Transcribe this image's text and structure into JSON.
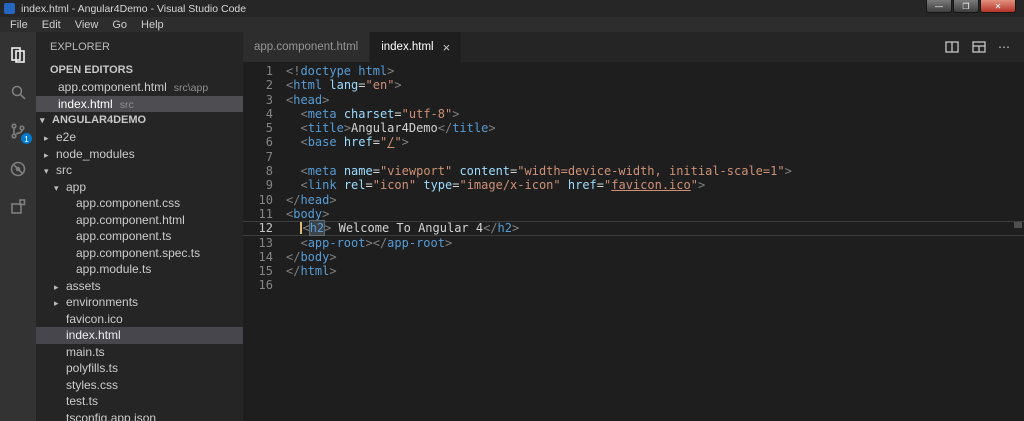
{
  "window": {
    "title": "index.html - Angular4Demo - Visual Studio Code",
    "controls": {
      "minimize": "—",
      "maximize": "❐",
      "close": "✕"
    }
  },
  "menu": {
    "items": [
      "File",
      "Edit",
      "View",
      "Go",
      "Help"
    ]
  },
  "activity_bar": {
    "source_control_badge": "1"
  },
  "sidebar": {
    "title": "EXPLORER",
    "open_editors_label": "OPEN EDITORS",
    "open_editors": [
      {
        "name": "app.component.html",
        "path": "src\\app",
        "selected": false
      },
      {
        "name": "index.html",
        "path": "src",
        "selected": true
      }
    ],
    "project_label": "ANGULAR4DEMO",
    "tree": [
      {
        "label": "e2e",
        "type": "folder",
        "expanded": false,
        "level": 0
      },
      {
        "label": "node_modules",
        "type": "folder",
        "expanded": false,
        "level": 0
      },
      {
        "label": "src",
        "type": "folder",
        "expanded": true,
        "level": 0
      },
      {
        "label": "app",
        "type": "folder",
        "expanded": true,
        "level": 1
      },
      {
        "label": "app.component.css",
        "type": "file",
        "level": 2
      },
      {
        "label": "app.component.html",
        "type": "file",
        "level": 2
      },
      {
        "label": "app.component.ts",
        "type": "file",
        "level": 2
      },
      {
        "label": "app.component.spec.ts",
        "type": "file",
        "level": 2
      },
      {
        "label": "app.module.ts",
        "type": "file",
        "level": 2
      },
      {
        "label": "assets",
        "type": "folder",
        "expanded": false,
        "level": 1
      },
      {
        "label": "environments",
        "type": "folder",
        "expanded": false,
        "level": 1
      },
      {
        "label": "favicon.ico",
        "type": "file",
        "level": 1
      },
      {
        "label": "index.html",
        "type": "file",
        "level": 1,
        "selected": true
      },
      {
        "label": "main.ts",
        "type": "file",
        "level": 1
      },
      {
        "label": "polyfills.ts",
        "type": "file",
        "level": 1
      },
      {
        "label": "styles.css",
        "type": "file",
        "level": 1
      },
      {
        "label": "test.ts",
        "type": "file",
        "level": 1
      },
      {
        "label": "tsconfig.app.json",
        "type": "file",
        "level": 1
      }
    ]
  },
  "tabs": [
    {
      "label": "app.component.html",
      "active": false
    },
    {
      "label": "index.html",
      "active": true
    }
  ],
  "tab_close": "×",
  "editor": {
    "lines": [
      {
        "tokens": [
          [
            "p",
            "<!"
          ],
          [
            "t",
            "doctype html"
          ],
          [
            "p",
            ">"
          ]
        ]
      },
      {
        "tokens": [
          [
            "p",
            "<"
          ],
          [
            "t",
            "html"
          ],
          [
            "x",
            " "
          ],
          [
            "a",
            "lang"
          ],
          [
            "o",
            "="
          ],
          [
            "v",
            "\"en\""
          ],
          [
            "p",
            ">"
          ]
        ]
      },
      {
        "tokens": [
          [
            "p",
            "<"
          ],
          [
            "t",
            "head"
          ],
          [
            "p",
            ">"
          ]
        ]
      },
      {
        "tokens": [
          [
            "x",
            "  "
          ],
          [
            "p",
            "<"
          ],
          [
            "t",
            "meta"
          ],
          [
            "x",
            " "
          ],
          [
            "a",
            "charset"
          ],
          [
            "o",
            "="
          ],
          [
            "v",
            "\"utf-8\""
          ],
          [
            "p",
            ">"
          ]
        ]
      },
      {
        "tokens": [
          [
            "x",
            "  "
          ],
          [
            "p",
            "<"
          ],
          [
            "t",
            "title"
          ],
          [
            "p",
            ">"
          ],
          [
            "x",
            "Angular4Demo"
          ],
          [
            "p",
            "</"
          ],
          [
            "t",
            "title"
          ],
          [
            "p",
            ">"
          ]
        ]
      },
      {
        "tokens": [
          [
            "x",
            "  "
          ],
          [
            "p",
            "<"
          ],
          [
            "t",
            "base"
          ],
          [
            "x",
            " "
          ],
          [
            "a",
            "href"
          ],
          [
            "o",
            "="
          ],
          [
            "v",
            "\""
          ],
          [
            "u",
            "/"
          ],
          [
            "v",
            "\""
          ],
          [
            "p",
            ">"
          ]
        ]
      },
      {
        "tokens": []
      },
      {
        "tokens": [
          [
            "x",
            "  "
          ],
          [
            "p",
            "<"
          ],
          [
            "t",
            "meta"
          ],
          [
            "x",
            " "
          ],
          [
            "a",
            "name"
          ],
          [
            "o",
            "="
          ],
          [
            "v",
            "\"viewport\""
          ],
          [
            "x",
            " "
          ],
          [
            "a",
            "content"
          ],
          [
            "o",
            "="
          ],
          [
            "v",
            "\"width=device-width, initial-scale=1\""
          ],
          [
            "p",
            ">"
          ]
        ]
      },
      {
        "tokens": [
          [
            "x",
            "  "
          ],
          [
            "p",
            "<"
          ],
          [
            "t",
            "link"
          ],
          [
            "x",
            " "
          ],
          [
            "a",
            "rel"
          ],
          [
            "o",
            "="
          ],
          [
            "v",
            "\"icon\""
          ],
          [
            "x",
            " "
          ],
          [
            "a",
            "type"
          ],
          [
            "o",
            "="
          ],
          [
            "v",
            "\"image/x-icon\""
          ],
          [
            "x",
            " "
          ],
          [
            "a",
            "href"
          ],
          [
            "o",
            "="
          ],
          [
            "v",
            "\""
          ],
          [
            "u",
            "favicon.ico"
          ],
          [
            "v",
            "\""
          ],
          [
            "p",
            ">"
          ]
        ]
      },
      {
        "tokens": [
          [
            "p",
            "</"
          ],
          [
            "t",
            "head"
          ],
          [
            "p",
            ">"
          ]
        ]
      },
      {
        "tokens": [
          [
            "p",
            "<"
          ],
          [
            "t",
            "body"
          ],
          [
            "p",
            ">"
          ]
        ]
      },
      {
        "current": true,
        "tokens": [
          [
            "x",
            "  "
          ],
          [
            "cur",
            ""
          ],
          [
            "p",
            "<"
          ],
          [
            "th",
            "h2"
          ],
          [
            "p",
            ">"
          ],
          [
            "x",
            " Welcome To Angular 4"
          ],
          [
            "p",
            "</"
          ],
          [
            "t",
            "h2"
          ],
          [
            "p",
            ">"
          ]
        ]
      },
      {
        "tokens": [
          [
            "x",
            "  "
          ],
          [
            "p",
            "<"
          ],
          [
            "t",
            "app-root"
          ],
          [
            "p",
            ">"
          ],
          [
            "p",
            "</"
          ],
          [
            "t",
            "app-root"
          ],
          [
            "p",
            ">"
          ]
        ]
      },
      {
        "tokens": [
          [
            "p",
            "</"
          ],
          [
            "t",
            "body"
          ],
          [
            "p",
            ">"
          ]
        ]
      },
      {
        "tokens": [
          [
            "p",
            "</"
          ],
          [
            "t",
            "html"
          ],
          [
            "p",
            ">"
          ]
        ]
      },
      {
        "tokens": []
      }
    ]
  }
}
